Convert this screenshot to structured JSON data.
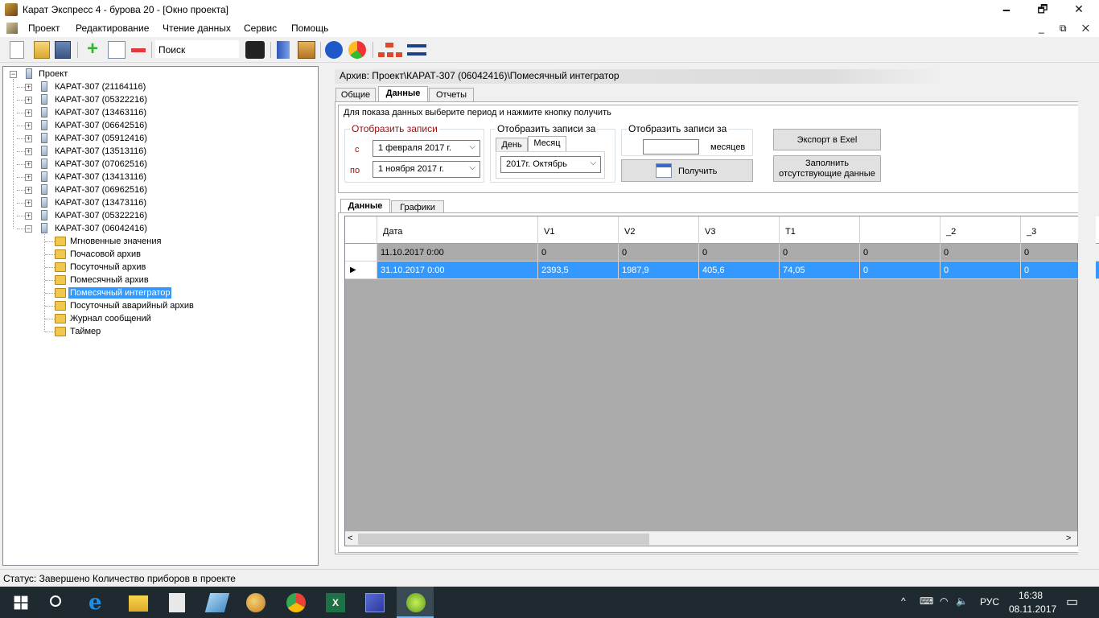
{
  "window": {
    "title": "Карат Экспресс 4 - бурова 20 - [Окно проекта]",
    "minimize": "🗕",
    "restore": "🗗",
    "close": "✕"
  },
  "menu": {
    "items": [
      "Проект",
      "Редактирование",
      "Чтение данных",
      "Сервис",
      "Помощь"
    ],
    "mdi": "_ ⧉ ✕"
  },
  "toolbar": {
    "search_label": "Поиск"
  },
  "tree": {
    "root": "Проект",
    "devices": [
      "КАРАТ-307 (21164116)",
      "КАРАТ-307 (05322216)",
      "КАРАТ-307 (13463116)",
      "КАРАТ-307 (06642516)",
      "КАРАТ-307 (05912416)",
      "КАРАТ-307 (13513116)",
      "КАРАТ-307 (07062516)",
      "КАРАТ-307 (13413116)",
      "КАРАТ-307 (06962516)",
      "КАРАТ-307 (13473116)",
      "КАРАТ-307 (05322216)",
      "КАРАТ-307 (06042416)"
    ],
    "archives": [
      "Мгновенные значения",
      "Почасовой архив",
      "Посуточный архив",
      "Помесячный архив",
      "Помесячный интегратор",
      "Посуточный аварийный архив",
      "Журнал сообщений",
      "Таймер"
    ],
    "selected_archive": "Помесячный интегратор"
  },
  "archive": {
    "header": "Архив: Проект\\КАРАТ-307 (06042416)\\Помесячный интегратор",
    "tabs": [
      "Общие",
      "Данные",
      "Отчеты"
    ],
    "active_tab": "Данные"
  },
  "filter": {
    "instruction": "Для показа данных выберите период и нажмите кнопку получить",
    "range_title": "Отобразить записи",
    "from_label": "с",
    "from_value": "1 февраля  2017 г.",
    "to_label": "по",
    "to_value": "1  ноября   2017 г.",
    "period_title": "Отобразить записи за",
    "period_tabs": [
      "День",
      "Месяц"
    ],
    "period_value": "2017г. Октябрь",
    "months_title": "Отобразить записи за",
    "months_value": "",
    "months_unit": "месяцев",
    "get_button": "Получить",
    "export_button": "Экспорт в Exel",
    "fill_button_line1": "Заполнить",
    "fill_button_line2": "отсутствующие данные"
  },
  "data_tabs": [
    "Данные",
    "Графики"
  ],
  "table": {
    "columns": [
      "Дата",
      "V1",
      "V2",
      "V3",
      "T1",
      "",
      "_2",
      "_3"
    ],
    "rows": [
      [
        "11.10.2017 0:00",
        "0",
        "0",
        "0",
        "0",
        "0",
        "0",
        "0"
      ],
      [
        "31.10.2017 0:00",
        "2393,5",
        "1987,9",
        "405,6",
        "74,05",
        "0",
        "0",
        "0"
      ]
    ],
    "selected_row": 1,
    "row_marker": "▶",
    "scroll_left": "<",
    "scroll_right": ">"
  },
  "status": {
    "text": "Статус:  Завершено  Количество приборов в проекте"
  },
  "taskbar": {
    "language": "РУС",
    "time": "16:38",
    "date": "08.11.2017",
    "tray_icons": [
      "^",
      "⌨",
      "◠",
      "🔈"
    ],
    "notify": "▭"
  }
}
